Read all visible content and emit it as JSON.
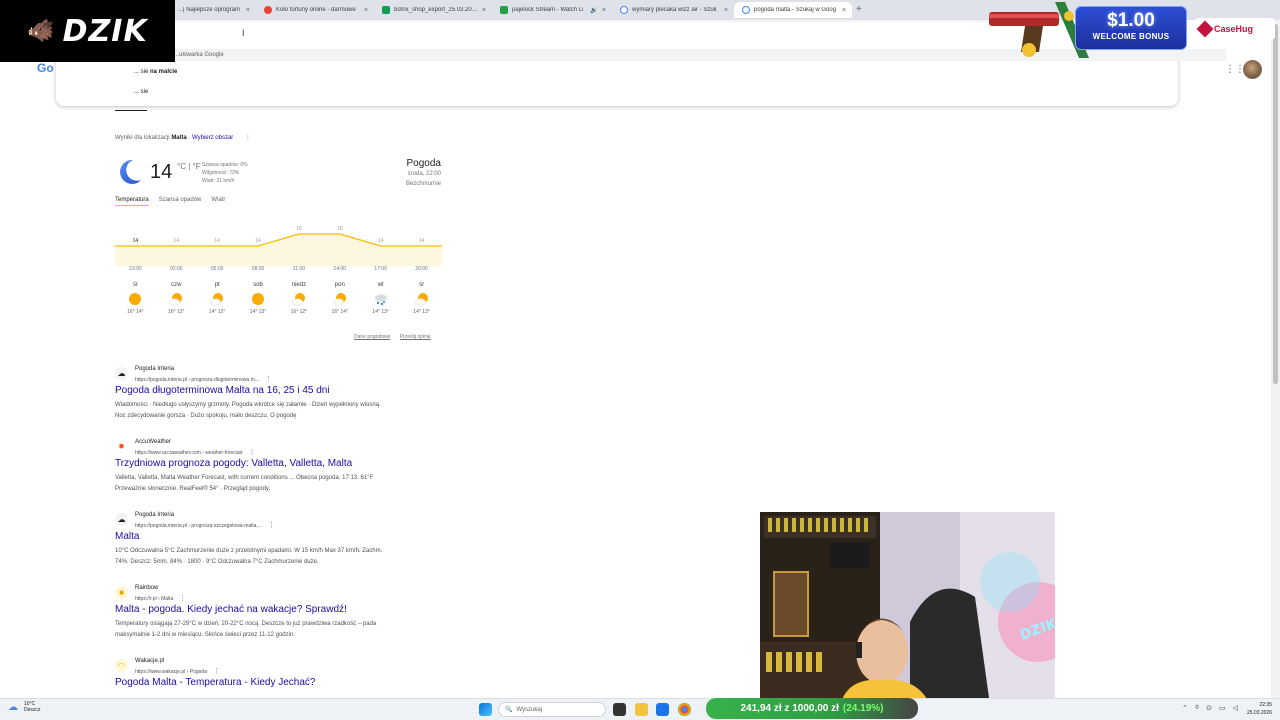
{
  "browser": {
    "tabs": [
      {
        "label": "...| Najlepsze oprogram",
        "color": "#5b9bd5",
        "active": false
      },
      {
        "label": "Koło fortuny online - darmowe",
        "color": "#ea4335",
        "active": false
      },
      {
        "label": "botrix_shop_export_25.03.2026",
        "color": "#0f9d58",
        "active": false
      },
      {
        "label": "pajelock Stream - Watch Li",
        "color": "#24a148",
        "active": false
      },
      {
        "label": "wymiary plecaka wizz air - Szuk",
        "color": "#4285f4",
        "active": false
      },
      {
        "label": "pogoda malta - Szukaj w Goog",
        "color": "#4285f4",
        "active": true
      }
    ],
    "close_glyph": "×",
    "new_tab_glyph": "+"
  },
  "overlay": {
    "logo_text": "DZIK",
    "ad_amount": "$1.00",
    "ad_text": "WELCOME BONUS",
    "ad_brand": "CaseHug"
  },
  "search": {
    "suggestion_header": "...ukiwarka Google",
    "suggestions": [
      {
        "prefix": "... sie ",
        "bold": "na malcie"
      },
      {
        "prefix": "... sie",
        "bold": ""
      }
    ],
    "google_letter": "Go"
  },
  "weather": {
    "location_prefix": "Wyniki dla lokalizacji",
    "location": "Malta",
    "change_area": "Wybierz obszar",
    "temperature": "14",
    "unit": "°C | °F",
    "precip": "Szansa opadów: 0%",
    "humidity": "Wilgotność: 72%",
    "wind": "Wiatr: 21 km/h",
    "title": "Pogoda",
    "day_time": "środa, 22:00",
    "condition": "Bezchmurnie",
    "tabs": [
      "Temperatura",
      "Szansa opadów",
      "Wiatr"
    ],
    "hours": [
      "23:00",
      "02:00",
      "05:00",
      "08:00",
      "11:00",
      "14:00",
      "17:00",
      "20:00"
    ],
    "footer_links": [
      "Dane pogodowe",
      "Prześlij opinię"
    ],
    "days": [
      {
        "name": "śr",
        "temps": "16° 14°",
        "icon": "sunny"
      },
      {
        "name": "czw",
        "temps": "16° 12°",
        "icon": "partly-cloudy"
      },
      {
        "name": "pt",
        "temps": "14° 12°",
        "icon": "partly-cloudy"
      },
      {
        "name": "sob",
        "temps": "14° 13°",
        "icon": "sunny"
      },
      {
        "name": "niedz",
        "temps": "16° 12°",
        "icon": "partly-cloudy"
      },
      {
        "name": "pon",
        "temps": "16° 14°",
        "icon": "partly-cloudy"
      },
      {
        "name": "wt",
        "temps": "14° 13°",
        "icon": "rain"
      },
      {
        "name": "śr",
        "temps": "14° 13°",
        "icon": "partly-cloudy"
      }
    ]
  },
  "chart_data": {
    "type": "area",
    "x": [
      "23:00",
      "02:00",
      "05:00",
      "08:00",
      "11:00",
      "14:00",
      "17:00",
      "20:00"
    ],
    "series": [
      {
        "values": [
          14,
          14,
          14,
          14,
          16,
          16,
          14,
          14
        ]
      }
    ],
    "point_labels": [
      "14",
      "14",
      "14",
      "14",
      "16",
      "16",
      "14",
      "14"
    ],
    "ylim": [
      12,
      17
    ],
    "color": "#fbbc04"
  },
  "results": [
    {
      "site": "Pogoda Interia",
      "url": "https://pogoda.interia.pl › prognoza-dlugoterminowa m...",
      "title": "Pogoda długoterminowa Malta na 16, 25 i 45 dni",
      "snippet_line1": "Wiadomości · Niedługo usłyszymy grzmoty. Pogoda wkrótce się załamie · Dzień wypełniony wiosną.",
      "snippet_line2": "Noc zdecydowanie gorsza · Dużo spokoju, mało deszczu. O pogodę",
      "favicon": "cloud-icon",
      "fav_color": "#5f8fd8"
    },
    {
      "site": "AccuWeather",
      "url": "https://www.accuweather.com › weather-forecast",
      "title": "Trzydniowa prognoza pogody: Valletta, Valletta, Malta",
      "snippet_line1": "Valletta, Valletta, Malta Weather Forecast, with current conditions ... Obecna pogoda. 17:13. 61°F",
      "snippet_line2": "Przeważnie słonecznie. RealFeel® 54° · Przegląd pogody.",
      "favicon": "sun-icon",
      "fav_color": "#f05514"
    },
    {
      "site": "Pogoda Interia",
      "url": "https://pogoda.interia.pl › prognoza-szczegolowa-malta,...",
      "title": "Malta",
      "snippet_line1": "10°C Odczuwalna 5°C Zachmurzenie duże z przelotnymi opadami. W 15 km/h Max 37 km/h. Zachm.",
      "snippet_line2": "74%. Deszcz: 5mm. 84% · 1800 · 9°C Odczuwalna 7°C Zachmurzenie duże.",
      "favicon": "cloud-icon",
      "fav_color": "#5f8fd8"
    },
    {
      "site": "Rainbow",
      "url": "https://r.pl › Malta",
      "title": "Malta - pogoda. Kiedy jechać na wakacje? Sprawdź!",
      "snippet_line1": "Temperatury osiągają 27-29°C w dzień, 20-22°C nocą. Deszcze to już prawdziwa rzadkość – pada",
      "snippet_line2": "maksymalnie 1-2 dni w miesiącu. Słońce świeci przez 11-12 godzin.",
      "favicon": "rainbow-icon",
      "fav_color": "#ffcc00"
    },
    {
      "site": "Wakacje.pl",
      "url": "https://www.wakacje.pl › Pogoda",
      "title": "Pogoda Malta - Temperatura - Kiedy Jechać?",
      "snippet_line1": "",
      "snippet_line2": "",
      "favicon": "sun-icon",
      "fav_color": "#ffd54f"
    }
  ],
  "taskbar": {
    "weather_temp": "10°C",
    "weather_cond": "Deszcz",
    "search_placeholder": "Wyszukaj",
    "donation_text": "241,94 zł z 1000,00 zł",
    "donation_pct": "(24.19%)",
    "donation_fraction": 0.2419,
    "time": "22:35",
    "date": "25.03.2026"
  }
}
